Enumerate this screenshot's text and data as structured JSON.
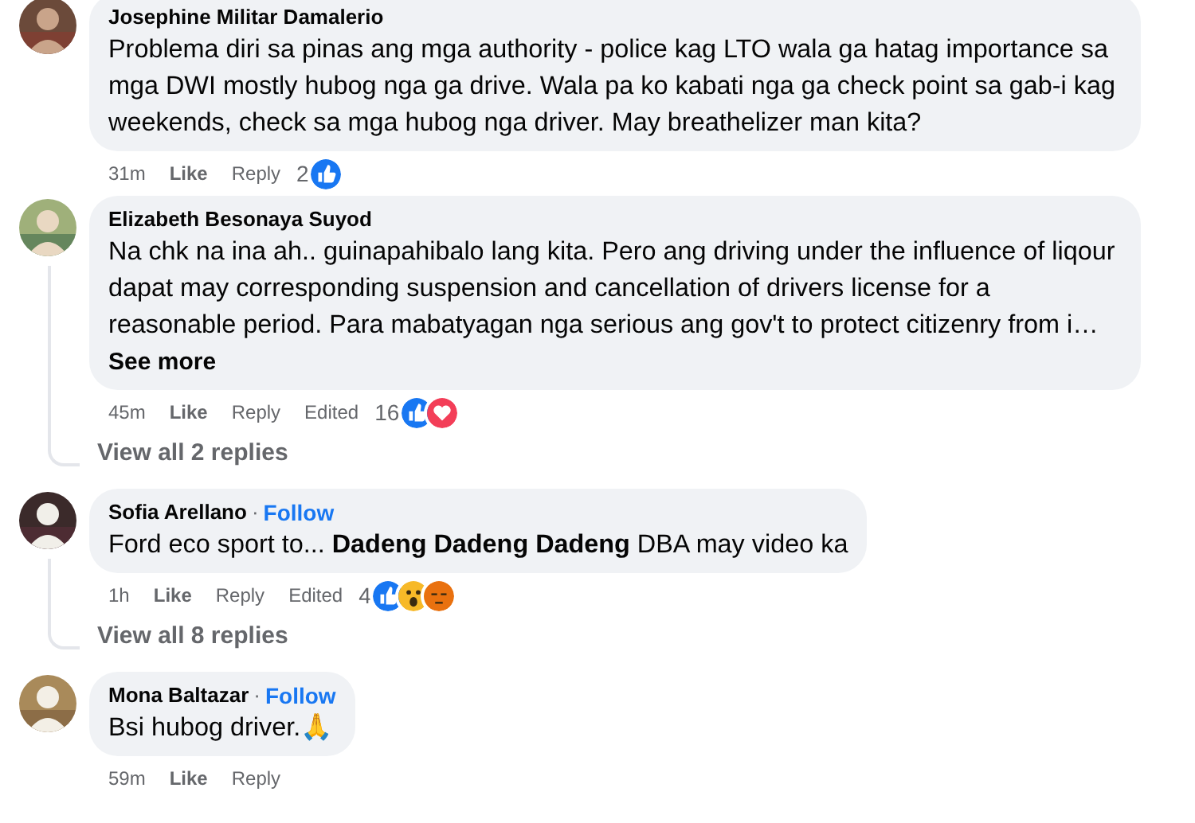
{
  "comments": [
    {
      "author": "Josephine Militar Damalerio",
      "avatar": {
        "kind": "picture"
      },
      "text": "Problema diri sa pinas ang mga authority - police kag LTO wala ga hatag importance sa mga DWI mostly hubog nga ga drive. Wala pa ko kabati nga ga check point sa gab-i kag weekends, check sa mga hubog nga driver. May breathelizer man kita?",
      "time": "31m",
      "actions": [
        "Like",
        "Reply"
      ],
      "reaction_count": "2",
      "reactions": [
        {
          "kind": "like"
        }
      ]
    },
    {
      "author": "Elizabeth Besonaya Suyod",
      "avatar": {
        "kind": "picture"
      },
      "text": "Na chk na ina ah.. guinapahibalo lang kita. Pero ang driving under the influence of liqour dapat may corresponding suspension and cancellation of drivers license for a reasonable period. Para mabatyagan nga serious ang gov't to protect citizenry from i…",
      "see_more": "See more",
      "time": "45m",
      "actions": [
        "Like",
        "Reply"
      ],
      "edited": "Edited",
      "reaction_count": "16",
      "reactions": [
        {
          "kind": "like"
        },
        {
          "kind": "love"
        }
      ],
      "replies_link": "View all 2 replies"
    },
    {
      "author": "Sofia Arellano",
      "separator": "·",
      "follow": "Follow",
      "avatar": {
        "kind": "picture"
      },
      "text": "Ford eco sport to... **Dadeng Dadeng Dadeng** DBA may video ka",
      "time": "1h",
      "actions": [
        "Like",
        "Reply"
      ],
      "edited": "Edited",
      "reaction_count": "4",
      "reactions": [
        {
          "kind": "like"
        },
        {
          "kind": "wow"
        },
        {
          "kind": "angry"
        }
      ],
      "replies_link": "View all 8 replies"
    },
    {
      "author": "Mona Baltazar",
      "separator": "·",
      "follow": "Follow",
      "avatar": {
        "kind": "picture"
      },
      "text": "Bsi hubog driver.🙏",
      "time": "59m",
      "actions": [
        "Like",
        "Reply"
      ]
    }
  ]
}
